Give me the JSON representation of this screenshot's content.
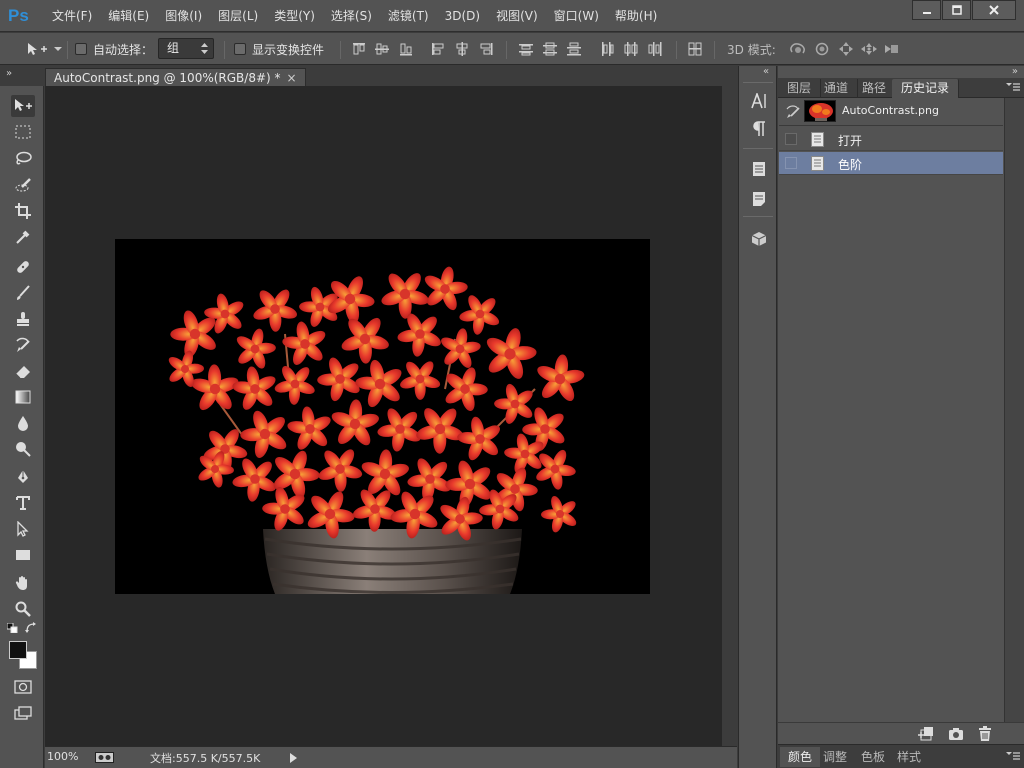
{
  "app": {
    "logo": "Ps"
  },
  "menu": [
    "文件(F)",
    "编辑(E)",
    "图像(I)",
    "图层(L)",
    "类型(Y)",
    "选择(S)",
    "滤镜(T)",
    "3D(D)",
    "视图(V)",
    "窗口(W)",
    "帮助(H)"
  ],
  "window_controls": {
    "minimize_icon": "minimize-icon",
    "maximize_icon": "maximize-icon",
    "close_icon": "close-icon"
  },
  "options_bar": {
    "auto_select_label": "自动选择：",
    "auto_select_checked": false,
    "auto_select_target": "组",
    "show_transform_label": "显示变换控件",
    "show_transform_checked": false,
    "mode_3d_label": "3D 模式:"
  },
  "document": {
    "tab_title": "AutoContrast.png @ 100%(RGB/8#) *",
    "close_glyph": "×"
  },
  "status": {
    "zoom": "100%",
    "doc_info": "文档:557.5 K/557.5K"
  },
  "panel": {
    "tabs": [
      "图层",
      "通道",
      "路径",
      "历史记录"
    ],
    "active_tab": "历史记录",
    "snapshot_name": "AutoContrast.png",
    "history": [
      {
        "label": "打开",
        "selected": false
      },
      {
        "label": "色阶",
        "selected": true
      }
    ],
    "bottom_tabs": [
      "颜色",
      "调整",
      "色板",
      "样式"
    ],
    "bottom_active": "颜色"
  },
  "colors": {
    "chrome": "#535353",
    "canvas_bg": "#282828",
    "history_selected": "#6d7ea0",
    "ps_blue": "#2f8fd8",
    "flower_red": "#e8392c",
    "flower_orange": "#f07a1e"
  }
}
